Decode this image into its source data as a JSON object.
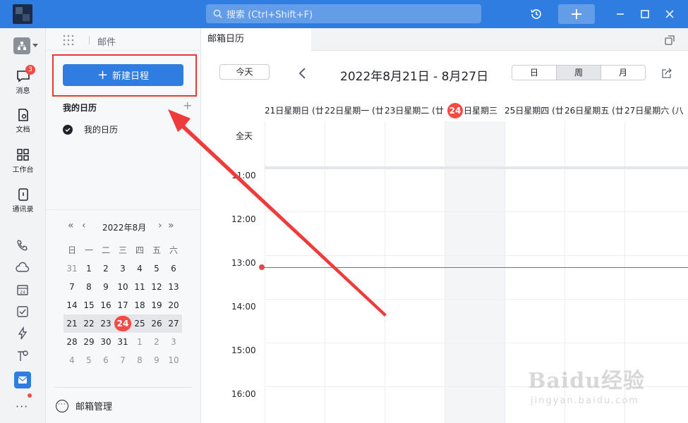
{
  "titlebar": {
    "search_placeholder": "搜索 (Ctrl+Shift+F)",
    "accent_color": "#2f7de1"
  },
  "rail": {
    "badge_count": "3",
    "items": [
      {
        "label": "消息",
        "icon": "message-icon"
      },
      {
        "label": "文档",
        "icon": "doc-icon"
      },
      {
        "label": "工作台",
        "icon": "workbench-icon"
      },
      {
        "label": "通讯录",
        "icon": "contacts-icon"
      }
    ],
    "extra_icons": [
      "phone-icon",
      "cloud-icon",
      "calendar-icon",
      "todo-icon",
      "lightning-icon",
      "tools-icon",
      "mail-icon",
      "more-icon"
    ]
  },
  "sidebar": {
    "title": "邮件",
    "new_button": "新建日程",
    "my_calendars_title": "我的日历",
    "calendars": [
      {
        "name": "我的日历",
        "checked": true
      }
    ],
    "mini_cal": {
      "month": "2022年8月",
      "weekdays": [
        "日",
        "一",
        "二",
        "三",
        "四",
        "五",
        "六"
      ],
      "weeks": [
        [
          "31",
          "1",
          "2",
          "3",
          "4",
          "5",
          "6"
        ],
        [
          "7",
          "8",
          "9",
          "10",
          "11",
          "12",
          "13"
        ],
        [
          "14",
          "15",
          "16",
          "17",
          "18",
          "19",
          "20"
        ],
        [
          "21",
          "22",
          "23",
          "24",
          "25",
          "26",
          "27"
        ],
        [
          "28",
          "29",
          "30",
          "31",
          "1",
          "2",
          "3"
        ],
        [
          "4",
          "5",
          "6",
          "7",
          "8",
          "9",
          "10"
        ]
      ],
      "today": "24",
      "highlight_week_index": 3
    },
    "mailbox_manage": "邮箱管理"
  },
  "main": {
    "tab_label": "邮箱日历",
    "today_button": "今天",
    "date_range": "2022年8月21日 - 8月27日",
    "views": [
      {
        "label": "日",
        "active": false
      },
      {
        "label": "周",
        "active": true
      },
      {
        "label": "月",
        "active": false
      }
    ],
    "day_headers": [
      {
        "label": "21日星期日 (廿",
        "today": false
      },
      {
        "label": "22日星期一 (廿",
        "today": false
      },
      {
        "label": "23日星期二 (廿",
        "today": false
      },
      {
        "label": "日星期三",
        "day": "24",
        "today": true
      },
      {
        "label": "25日星期四 (廿",
        "today": false
      },
      {
        "label": "26日星期五 (廿",
        "today": false
      },
      {
        "label": "27日星期六 (八",
        "today": false
      }
    ],
    "allday_label": "全天",
    "hours": [
      "11:00",
      "12:00",
      "13:00",
      "14:00",
      "15:00",
      "16:00"
    ],
    "current_time_color": "#e0484b"
  },
  "watermark": {
    "main": "Baidu经验",
    "sub": "jingyan.baidu.com"
  }
}
